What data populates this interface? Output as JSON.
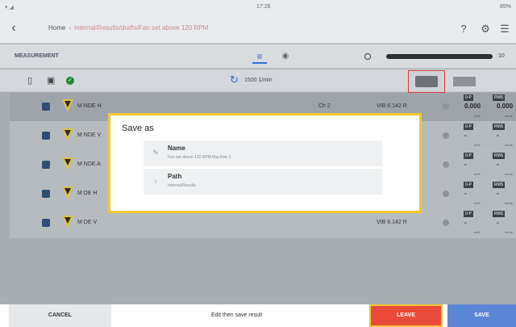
{
  "status": {
    "time": "17:26",
    "battery": "85%"
  },
  "header": {
    "home": "Home",
    "separator": "›",
    "path": "Internal/Results/drafts/Fan set above 120 RPM"
  },
  "toolbar": {
    "measurement_label": "MEASUREMENT",
    "slider_value": "10",
    "rpm": "1500 1/min"
  },
  "rows": [
    {
      "name": "M NDE H",
      "ch": "Ch",
      "ch_num": "2",
      "vib": "VIB 6.142 R",
      "tag1": "0-P",
      "tag2": "RMS",
      "v1": "0.000",
      "v2": "0.000",
      "u1": "m/s²",
      "u2": "mm/s"
    },
    {
      "name": "M NDE V",
      "ch": "",
      "ch_num": "",
      "vib": "",
      "tag1": "0-P",
      "tag2": "RMS",
      "v1": "-",
      "v2": "-",
      "u1": "m/s²",
      "u2": "mm/s"
    },
    {
      "name": "M NDE A",
      "ch": "",
      "ch_num": "",
      "vib": "",
      "tag1": "0-P",
      "tag2": "RMS",
      "v1": "-",
      "v2": "-",
      "u1": "m/s²",
      "u2": "mm/s"
    },
    {
      "name": "M DE H",
      "ch": "",
      "ch_num": "",
      "vib": "",
      "tag1": "0-P",
      "tag2": "RMS",
      "v1": "-",
      "v2": "-",
      "u1": "m/s²",
      "u2": "mm/s"
    },
    {
      "name": "M DE V",
      "ch": "",
      "ch_num": "",
      "vib": "VIB 6.142 R",
      "tag1": "0-P",
      "tag2": "RMS",
      "v1": "-",
      "v2": "-",
      "u1": "m/s²",
      "u2": "mm/s"
    }
  ],
  "dialog": {
    "title": "Save as",
    "name_label": "Name",
    "name_value": "Fan set above 120 RPM Machine 1",
    "path_label": "Path",
    "path_value": "Internal/Results"
  },
  "footer": {
    "cancel": "CANCEL",
    "hint": "Edit then save result",
    "leave": "LEAVE",
    "save": "SAVE"
  }
}
